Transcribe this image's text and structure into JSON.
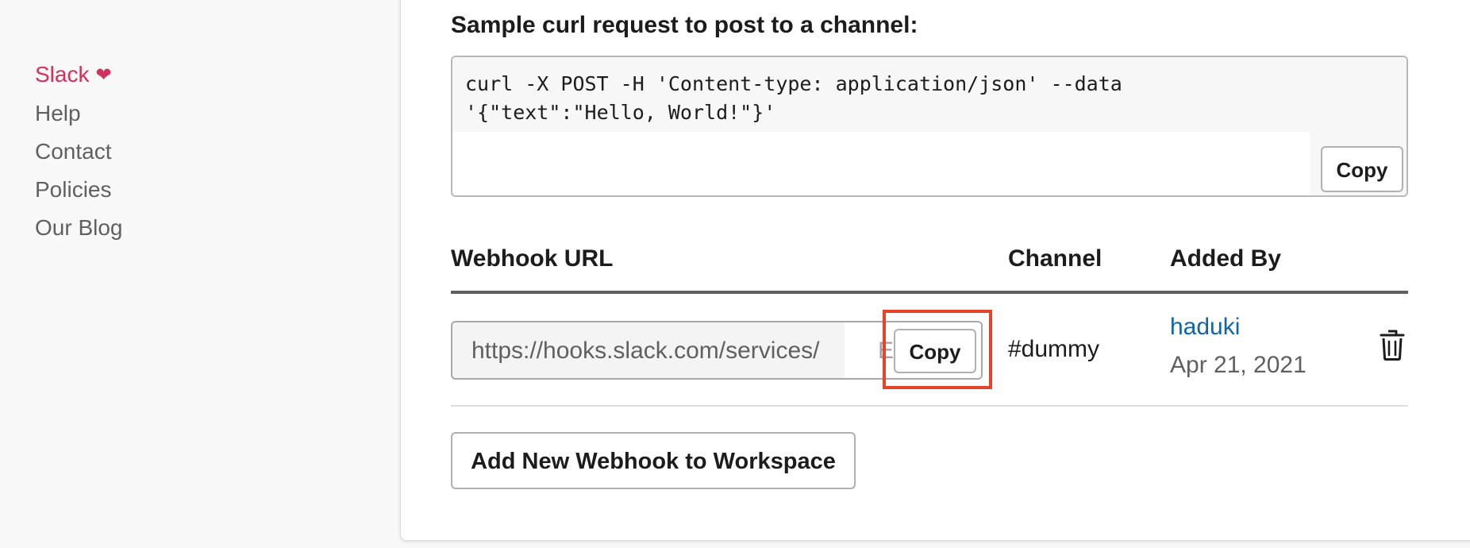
{
  "sidebar": {
    "brand_label": "Slack",
    "brand_icon": "heart-icon",
    "brand_color": "#d1325b",
    "items": [
      {
        "label": "Help"
      },
      {
        "label": "Contact"
      },
      {
        "label": "Policies"
      },
      {
        "label": "Our Blog"
      }
    ]
  },
  "sample": {
    "title": "Sample curl request to post to a channel:",
    "code": "curl -X POST -H 'Content-type: application/json' --data '{\"text\":\"Hello, World!\"}'",
    "copy_label": "Copy"
  },
  "table": {
    "headers": {
      "webhook_url": "Webhook URL",
      "channel": "Channel",
      "added_by": "Added By"
    },
    "rows": [
      {
        "url": "https://hooks.slack.com/services/",
        "url_tail": "E9",
        "copy_label": "Copy",
        "channel": "#dummy",
        "added_by_user": "haduki",
        "added_by_date": "Apr 21, 2021",
        "delete_icon": "trash-icon"
      }
    ]
  },
  "actions": {
    "add_webhook_label": "Add New Webhook to Workspace"
  },
  "colors": {
    "link": "#1264a3",
    "highlight": "#e5432a"
  }
}
